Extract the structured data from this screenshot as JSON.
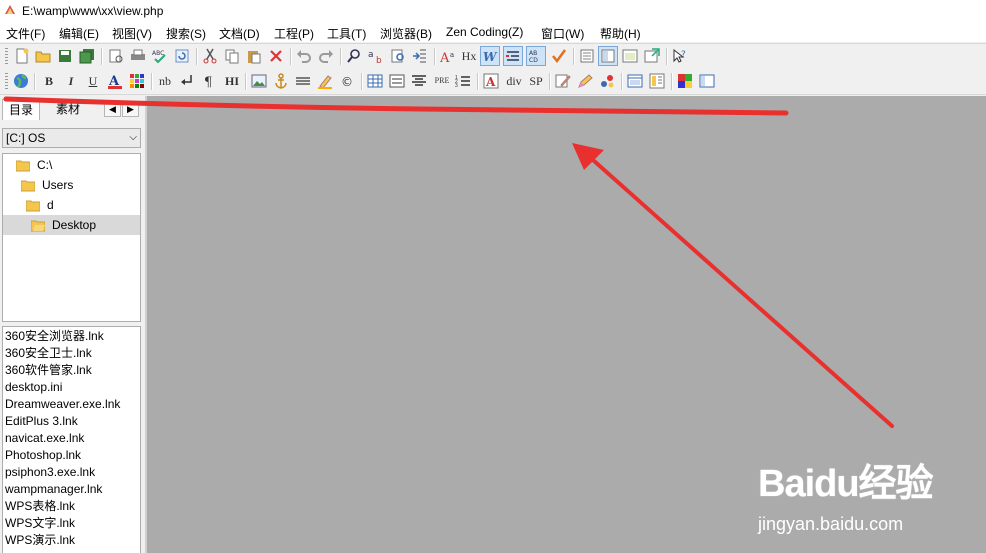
{
  "window": {
    "title": "E:\\wamp\\www\\xx\\view.php"
  },
  "menu": [
    "文件(F)",
    "编辑(E)",
    "视图(V)",
    "搜索(S)",
    "文档(D)",
    "工程(P)",
    "工具(T)",
    "浏览器(B)",
    "Zen Coding(Z)",
    "窗口(W)",
    "帮助(H)"
  ],
  "toolbar2_text": {
    "nb": "nb",
    "hx": "Hx",
    "pre": "PRE",
    "div": "div",
    "sp": "SP",
    "bold": "B",
    "italic": "I",
    "underline": "U",
    "hi": "HI"
  },
  "left_panel": {
    "tabs": [
      "目录",
      "素材"
    ],
    "drive": "[C:] OS",
    "tree": [
      "C:\\",
      "Users",
      "d",
      "Desktop"
    ],
    "selected_node": "Desktop",
    "files": [
      "360安全浏览器.lnk",
      "360安全卫士.lnk",
      "360软件管家.lnk",
      "desktop.ini",
      "Dreamweaver.exe.lnk",
      "EditPlus 3.lnk",
      "navicat.exe.lnk",
      "Photoshop.lnk",
      "psiphon3.exe.lnk",
      "wampmanager.lnk",
      "WPS表格.lnk",
      "WPS文字.lnk",
      "WPS演示.lnk"
    ]
  },
  "watermark": {
    "logo": "Baidu经验",
    "url": "jingyan.baidu.com"
  },
  "colors": {
    "annotation": "#e8302f",
    "workspace": "#ababab",
    "folder": "#f5c64c"
  }
}
